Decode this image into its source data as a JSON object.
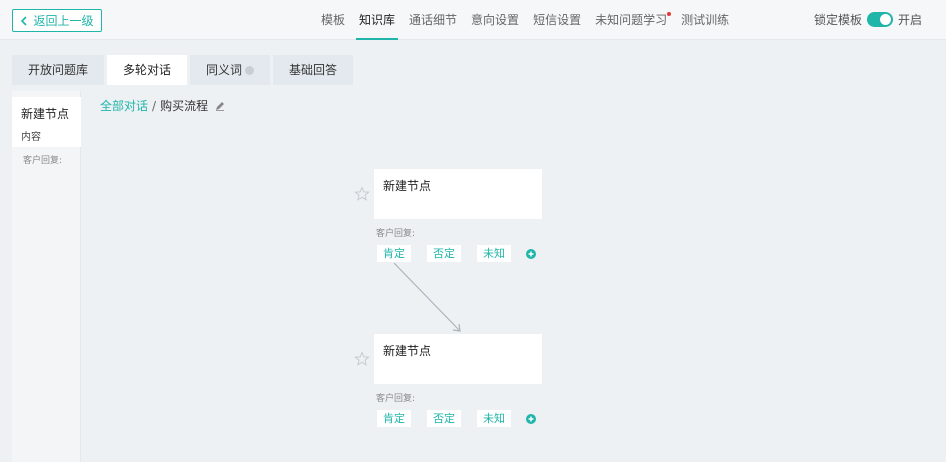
{
  "topbar": {
    "back_label": "返回上一级",
    "nav": [
      {
        "label": "模板",
        "active": false
      },
      {
        "label": "知识库",
        "active": true
      },
      {
        "label": "通话细节",
        "active": false
      },
      {
        "label": "意向设置",
        "active": false
      },
      {
        "label": "短信设置",
        "active": false
      },
      {
        "label": "未知问题学习",
        "active": false,
        "dot": true
      },
      {
        "label": "测试训练",
        "active": false
      }
    ],
    "lock_label": "锁定模板",
    "toggle_label": "开启"
  },
  "subtabs": [
    {
      "label": "开放问题库"
    },
    {
      "label": "多轮对话",
      "active": true
    },
    {
      "label": "同义词",
      "help": true
    },
    {
      "label": "基础回答"
    }
  ],
  "sidebar": {
    "card_title": "新建节点",
    "card_sub": "内容",
    "reply_label": "客户回复:"
  },
  "breadcrumb": {
    "root": "全部对话",
    "sep": "/",
    "current": "购买流程"
  },
  "nodes": [
    {
      "title": "新建节点",
      "reply_label": "客户回复:",
      "options": [
        "肯定",
        "否定",
        "未知"
      ]
    },
    {
      "title": "新建节点",
      "reply_label": "客户回复:",
      "options": [
        "肯定",
        "否定",
        "未知"
      ]
    }
  ],
  "colors": {
    "accent": "#1fb5a8",
    "alert_dot": "#e53935"
  }
}
